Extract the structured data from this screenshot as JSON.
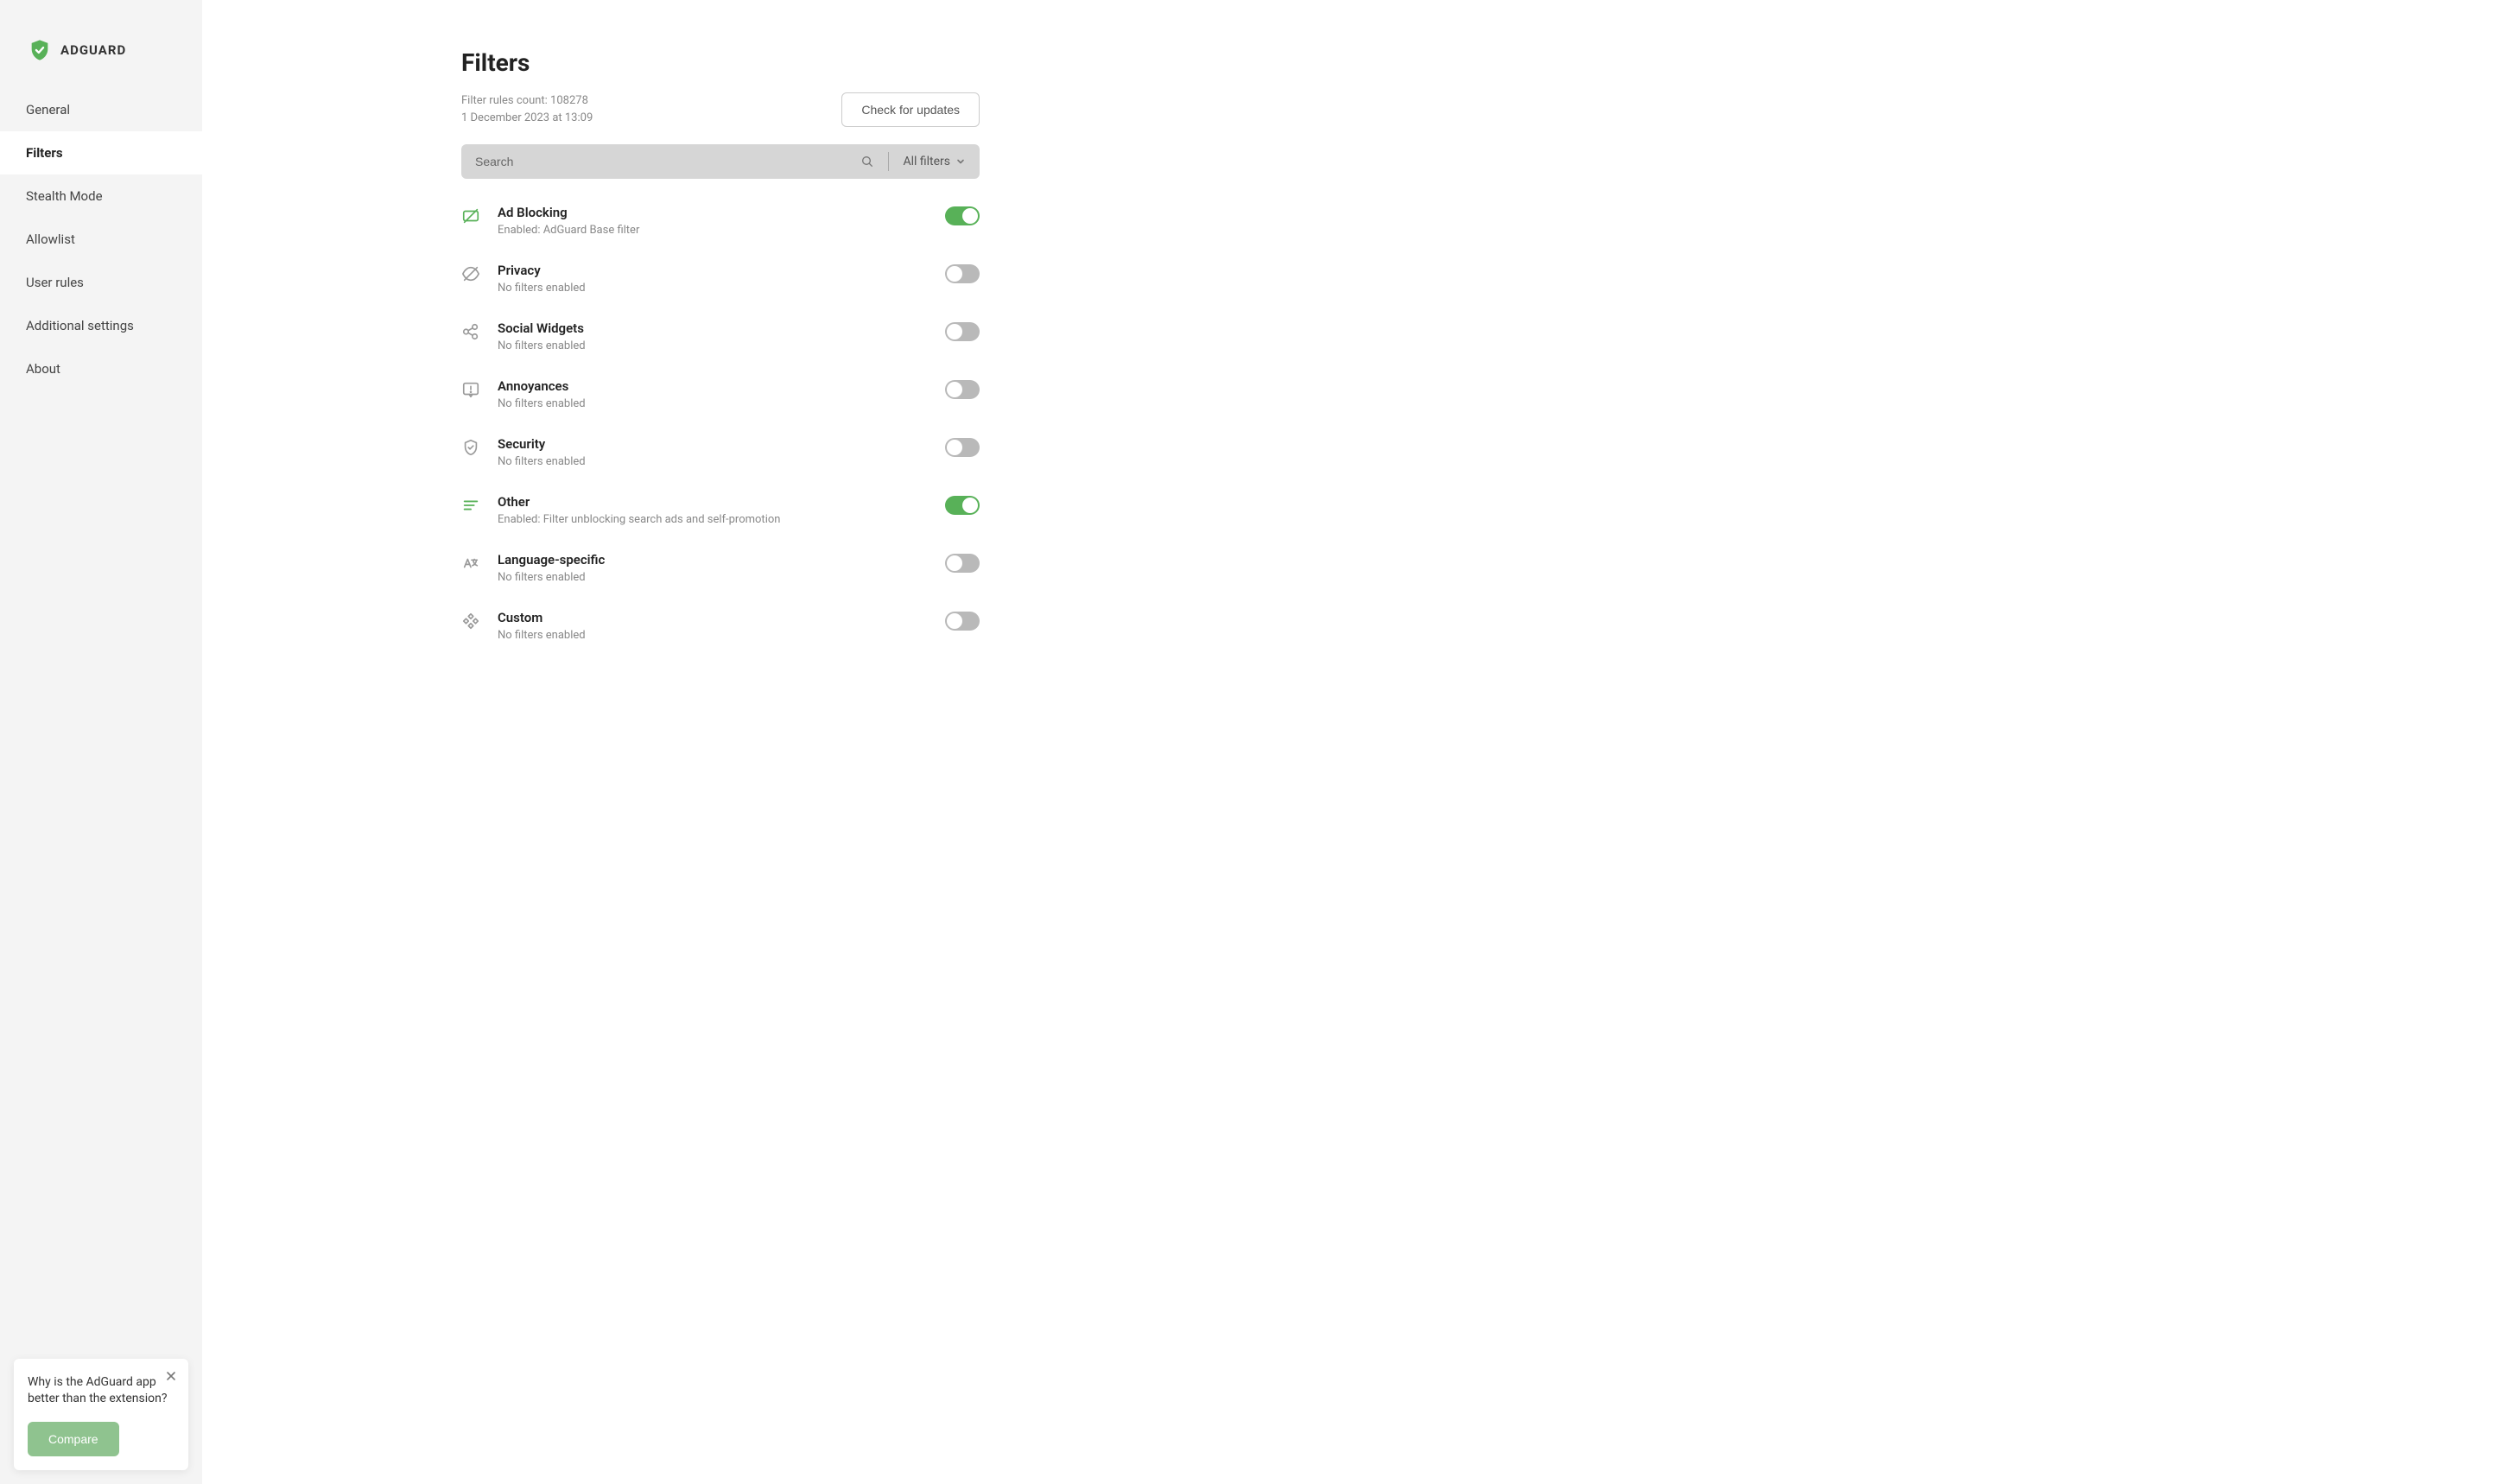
{
  "brand": {
    "name": "ADGUARD"
  },
  "sidebar": {
    "items": [
      {
        "label": "General"
      },
      {
        "label": "Filters"
      },
      {
        "label": "Stealth Mode"
      },
      {
        "label": "Allowlist"
      },
      {
        "label": "User rules"
      },
      {
        "label": "Additional settings"
      },
      {
        "label": "About"
      }
    ],
    "active_index": 1
  },
  "promo": {
    "text": "Why is the AdGuard app better than the extension?",
    "button": "Compare"
  },
  "page": {
    "title": "Filters",
    "rules_count_line": "Filter rules count: 108278",
    "updated_line": "1 December 2023 at 13:09",
    "check_updates_label": "Check for updates"
  },
  "search": {
    "placeholder": "Search",
    "dropdown_label": "All filters"
  },
  "categories": [
    {
      "icon": "ad-block-icon",
      "icon_color": "#58b158",
      "title": "Ad Blocking",
      "subtitle": "Enabled: AdGuard Base filter",
      "enabled": true
    },
    {
      "icon": "privacy-icon",
      "icon_color": "#9a9a9a",
      "title": "Privacy",
      "subtitle": "No filters enabled",
      "enabled": false
    },
    {
      "icon": "social-icon",
      "icon_color": "#9a9a9a",
      "title": "Social Widgets",
      "subtitle": "No filters enabled",
      "enabled": false
    },
    {
      "icon": "annoyance-icon",
      "icon_color": "#9a9a9a",
      "title": "Annoyances",
      "subtitle": "No filters enabled",
      "enabled": false
    },
    {
      "icon": "security-icon",
      "icon_color": "#9a9a9a",
      "title": "Security",
      "subtitle": "No filters enabled",
      "enabled": false
    },
    {
      "icon": "other-icon",
      "icon_color": "#58b158",
      "title": "Other",
      "subtitle": "Enabled: Filter unblocking search ads and self-promotion",
      "enabled": true
    },
    {
      "icon": "language-icon",
      "icon_color": "#9a9a9a",
      "title": "Language-specific",
      "subtitle": "No filters enabled",
      "enabled": false
    },
    {
      "icon": "custom-icon",
      "icon_color": "#9a9a9a",
      "title": "Custom",
      "subtitle": "No filters enabled",
      "enabled": false
    }
  ]
}
